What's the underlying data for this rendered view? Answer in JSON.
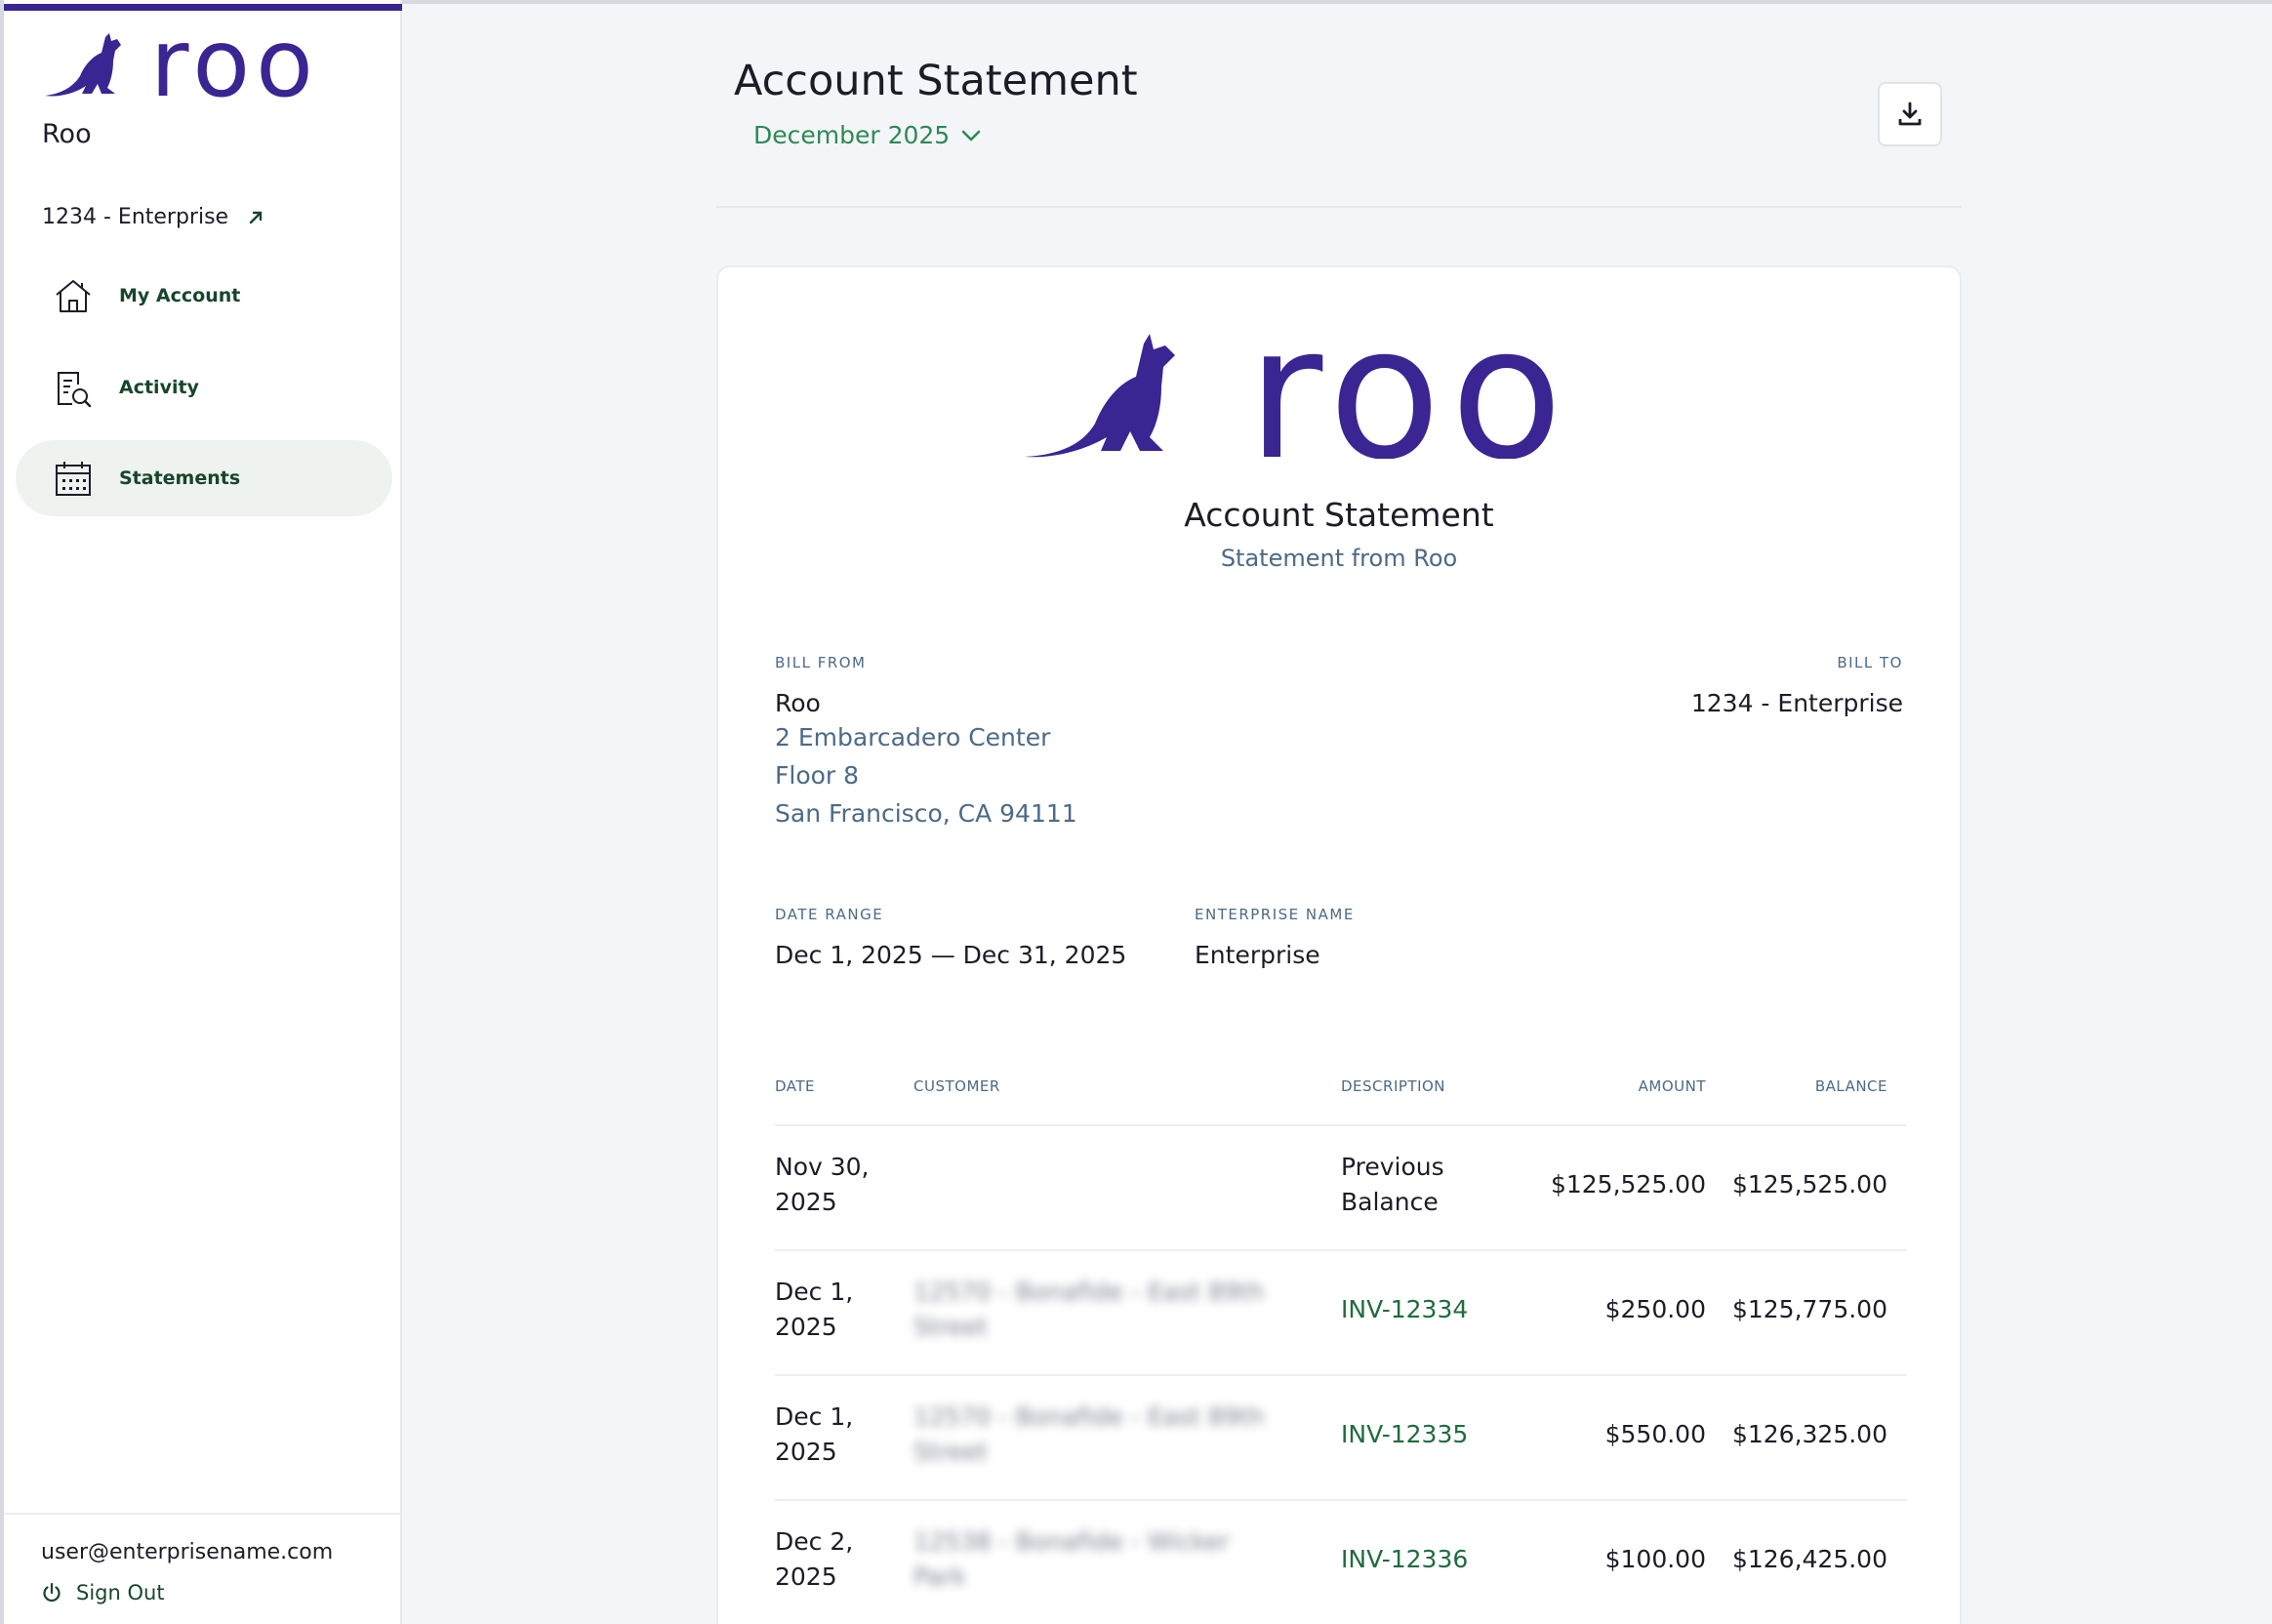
{
  "brand": {
    "wordmark": "roo",
    "color": "#3a2592",
    "accent_green": "#2c8a52"
  },
  "sidebar": {
    "org_name": "Roo",
    "account_link": "1234 - Enterprise",
    "items": [
      {
        "label": "My Account",
        "icon": "house-icon",
        "active": false
      },
      {
        "label": "Activity",
        "icon": "document-search-icon",
        "active": false
      },
      {
        "label": "Statements",
        "icon": "calendar-icon",
        "active": true
      }
    ],
    "user_email": "user@enterprisename.com",
    "sign_out_label": "Sign Out"
  },
  "header": {
    "title": "Account Statement",
    "month_selected": "December 2025"
  },
  "statement": {
    "title": "Account Statement",
    "subtitle": "Statement from Roo",
    "bill_from": {
      "label": "BILL FROM",
      "name": "Roo",
      "address_line1": "2 Embarcadero Center",
      "address_line2": "Floor 8",
      "address_line3": "San Francisco, CA 94111"
    },
    "bill_to": {
      "label": "BILL TO",
      "value": "1234 - Enterprise"
    },
    "date_range": {
      "label": "DATE RANGE",
      "value": "Dec 1, 2025 — Dec 31, 2025"
    },
    "enterprise_name": {
      "label": "ENTERPRISE NAME",
      "value": "Enterprise"
    },
    "table": {
      "columns": [
        "DATE",
        "CUSTOMER",
        "DESCRIPTION",
        "AMOUNT",
        "BALANCE"
      ],
      "rows": [
        {
          "date": "Nov 30, 2025",
          "customer": "",
          "description": "Previous Balance",
          "amount": "$125,525.00",
          "balance": "$125,525.00"
        },
        {
          "date": "Dec 1, 2025",
          "customer": "12570 - Bonafide - East 89th Street",
          "description": "INV-12334",
          "amount": "$250.00",
          "balance": "$125,775.00"
        },
        {
          "date": "Dec 1, 2025",
          "customer": "12570 - Bonafide - East 89th Street",
          "description": "INV-12335",
          "amount": "$550.00",
          "balance": "$126,325.00"
        },
        {
          "date": "Dec 2, 2025",
          "customer": "12538 - Bonafide - Wicker Park",
          "description": "INV-12336",
          "amount": "$100.00",
          "balance": "$126,425.00"
        }
      ]
    }
  }
}
